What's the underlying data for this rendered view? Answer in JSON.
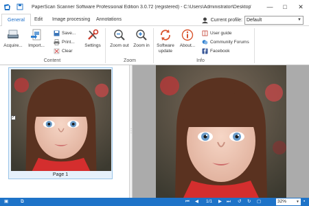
{
  "window": {
    "title": "PaperScan Scanner Software Professional Edition 3.0.72 (registered) - C:\\Users\\Administrator\\Desktop\\avaxho..."
  },
  "ribbon": {
    "tabs": [
      {
        "label": "General",
        "active": true
      },
      {
        "label": "Edit",
        "active": false
      },
      {
        "label": "Image processing",
        "active": false
      },
      {
        "label": "Annotations",
        "active": false
      }
    ],
    "profile": {
      "label": "Current profile:",
      "value": "Default"
    },
    "content_group": {
      "label": "Content",
      "acquire": "Acquire...",
      "import": "Import...",
      "save": "Save...",
      "print": "Print...",
      "clear": "Clear"
    },
    "settings_group": {
      "settings": "Settings"
    },
    "zoom_group": {
      "label": "Zoom",
      "zoom_out": "Zoom out",
      "zoom_in": "Zoom in"
    },
    "info_group": {
      "label": "Info",
      "software_update_1": "Software",
      "software_update_2": "update",
      "about": "About...",
      "user_guide": "User guide",
      "community_forums": "Community Forums",
      "facebook": "Facebook"
    }
  },
  "thumbnails": {
    "pages": [
      {
        "caption": "Page 1",
        "checked": true
      }
    ]
  },
  "statusbar": {
    "page_indicator": "1/1",
    "zoom": "32%"
  },
  "colors": {
    "accent": "#1e73c8",
    "viewer_bg": "#ababab",
    "thumb_selected_bg": "#e6f1fb"
  }
}
